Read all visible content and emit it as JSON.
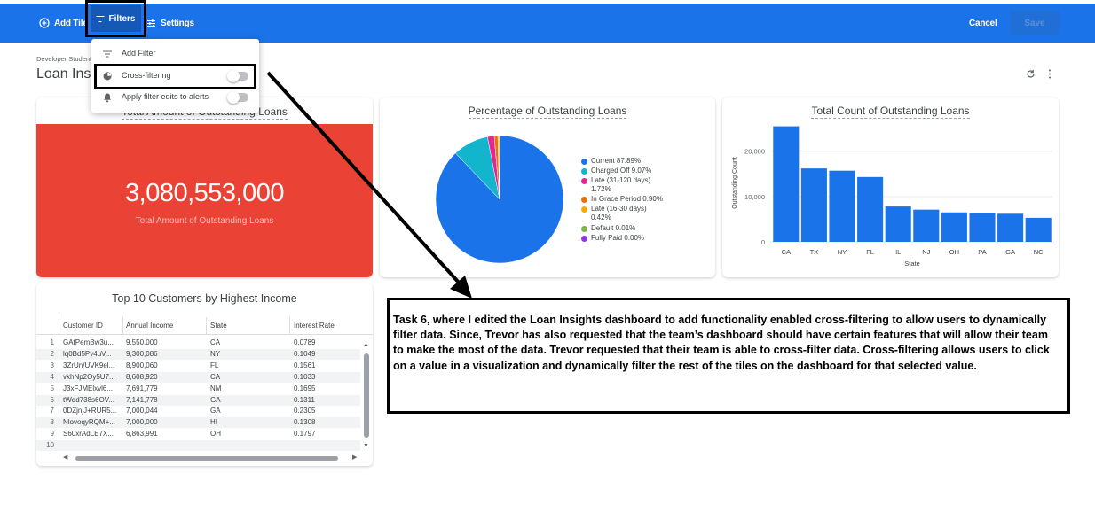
{
  "toolbar": {
    "add_tile_label": "Add Tile",
    "filters_label": "Filters",
    "settings_label": "Settings",
    "cancel_label": "Cancel",
    "save_label": "Save"
  },
  "dashboard": {
    "breadcrumb": "Developer Student",
    "title": "Loan Insights"
  },
  "filter_menu": {
    "items": [
      {
        "label": "Add Filter",
        "icon": "filter-lines-icon"
      },
      {
        "label": "Cross-filtering",
        "icon": "pie-chart-icon",
        "toggle": false
      },
      {
        "label": "Apply filter edits to alerts",
        "icon": "bell-icon",
        "toggle": false
      }
    ]
  },
  "tiles": {
    "total_amount": {
      "title": "Total Amount of Outstanding Loans",
      "value": "3,080,553,000",
      "subtitle": "Total Amount of Outstanding Loans",
      "color": "#ea4335"
    },
    "pie": {
      "title": "Percentage of Outstanding Loans",
      "legend": [
        {
          "line1": "Current 87.89%",
          "line2": ""
        },
        {
          "line1": "Charged Off 9.07%",
          "line2": ""
        },
        {
          "line1": "Late (31-120 days)",
          "line2": "1.72%"
        },
        {
          "line1": "In Grace Period 0.90%",
          "line2": ""
        },
        {
          "line1": "Late (16-30 days)",
          "line2": "0.42%"
        },
        {
          "line1": "Default 0.01%",
          "line2": ""
        },
        {
          "line1": "Fully Paid 0.00%",
          "line2": ""
        }
      ]
    },
    "bar": {
      "title": "Total Count of Outstanding Loans",
      "ylabel": "Outstanding Count",
      "xlabel": "State",
      "yticks": [
        "20,000",
        "10,000",
        "0"
      ]
    },
    "table": {
      "title": "Top 10 Customers by Highest Income",
      "columns": [
        "Customer ID",
        "Annual Income",
        "State",
        "Interest Rate"
      ],
      "rows": [
        [
          "1",
          "GAtPemBw3u...",
          "9,550,000",
          "CA",
          "0.0789"
        ],
        [
          "2",
          "lq0Bd5Pv4uV...",
          "9,300,086",
          "NY",
          "0.1049"
        ],
        [
          "3",
          "3ZrUn/UVK9el...",
          "8,900,060",
          "FL",
          "0.1561"
        ],
        [
          "4",
          "vkhNp2Oy5U7...",
          "8,608,920",
          "CA",
          "0.1033"
        ],
        [
          "5",
          "J3xFJMElxvl6...",
          "7,691,779",
          "NM",
          "0.1695"
        ],
        [
          "6",
          "tWqd738s6OV...",
          "7,141,778",
          "GA",
          "0.1311"
        ],
        [
          "7",
          "0DZjnjJ+RUR5...",
          "7,000,044",
          "GA",
          "0.2305"
        ],
        [
          "8",
          "NlovoqyRQM+...",
          "7,000,000",
          "HI",
          "0.1308"
        ],
        [
          "9",
          "S60xrAdLE7X...",
          "6,863,991",
          "OH",
          "0.1797"
        ],
        [
          "10",
          "",
          "",
          "",
          ""
        ]
      ]
    }
  },
  "chart_data": [
    {
      "type": "pie",
      "title": "Percentage of Outstanding Loans",
      "categories": [
        "Current",
        "Charged Off",
        "Late (31-120 days)",
        "In Grace Period",
        "Late (16-30 days)",
        "Default",
        "Fully Paid"
      ],
      "values": [
        87.89,
        9.07,
        1.72,
        0.9,
        0.42,
        0.01,
        0.0
      ],
      "colors": [
        "#1a73e8",
        "#12b5cb",
        "#e52592",
        "#e8710a",
        "#f9ab00",
        "#7cb342",
        "#9334e6"
      ],
      "legend": "right"
    },
    {
      "type": "bar",
      "title": "Total Count of Outstanding Loans",
      "categories": [
        "CA",
        "TX",
        "NY",
        "FL",
        "IL",
        "NJ",
        "OH",
        "PA",
        "GA",
        "NC"
      ],
      "values": [
        25500,
        16200,
        15700,
        14300,
        7800,
        7100,
        6500,
        6400,
        6200,
        5300
      ],
      "xlabel": "State",
      "ylabel": "Outstanding Count",
      "ylim": [
        0,
        26000
      ],
      "grid": true,
      "color": "#1a73e8"
    }
  ],
  "annotation": {
    "text": "Task 6, where I edited the Loan Insights dashboard to add functionality enabled cross-filtering to allow users to dynamically filter data. Since, Trevor has also requested that the team’s dashboard should have certain features that will allow their team to make the most of the data. Trevor requested that their team is able to cross-filter data. Cross-filtering allows users to click on a value in a visualization and dynamically filter the rest of the tiles on the dashboard for that selected value."
  }
}
